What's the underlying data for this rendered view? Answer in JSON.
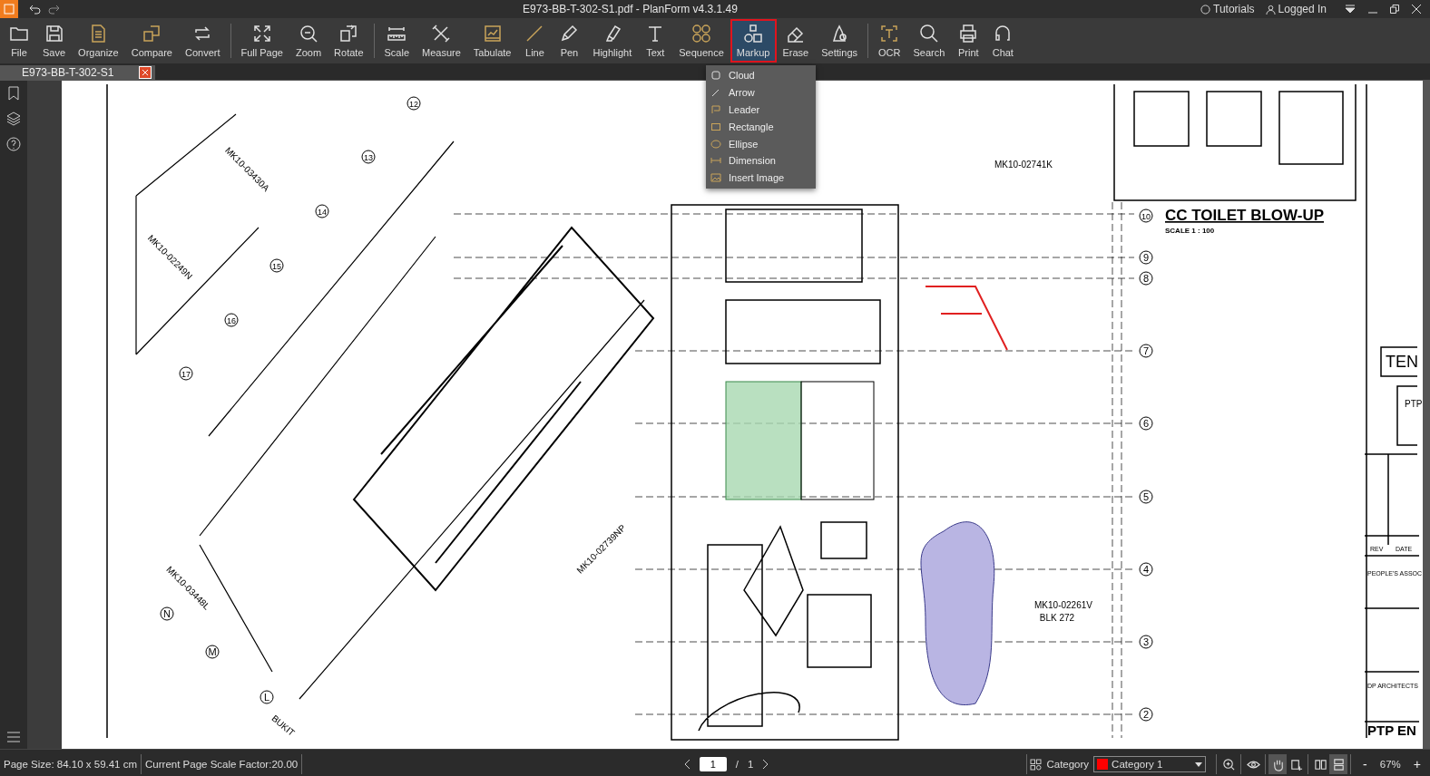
{
  "title_bar": {
    "title": "E973-BB-T-302-S1.pdf - PlanForm v4.3.1.49",
    "links": [
      "Tutorials",
      "Logged In"
    ]
  },
  "toolbar": {
    "groups": [
      [
        {
          "label": "File",
          "selected": false
        },
        {
          "label": "Save",
          "selected": false
        },
        {
          "label": "Organize",
          "selected": false
        },
        {
          "label": "Compare",
          "selected": false
        },
        {
          "label": "Convert",
          "selected": false
        }
      ],
      [
        {
          "label": "Full Page",
          "selected": false
        },
        {
          "label": "Zoom",
          "selected": false
        },
        {
          "label": "Rotate",
          "selected": false
        }
      ],
      [
        {
          "label": "Scale",
          "selected": false
        },
        {
          "label": "Measure",
          "selected": false
        },
        {
          "label": "Tabulate",
          "selected": false
        },
        {
          "label": "Line",
          "selected": false
        },
        {
          "label": "Pen",
          "selected": false
        },
        {
          "label": "Highlight",
          "selected": false
        },
        {
          "label": "Text",
          "selected": false
        },
        {
          "label": "Sequence",
          "selected": false
        },
        {
          "label": "Markup",
          "selected": true
        },
        {
          "label": "Erase",
          "selected": false
        },
        {
          "label": "Settings",
          "selected": false
        }
      ],
      [
        {
          "label": "OCR",
          "selected": false
        },
        {
          "label": "Search",
          "selected": false
        },
        {
          "label": "Print",
          "selected": false
        },
        {
          "label": "Chat",
          "selected": false
        }
      ]
    ]
  },
  "document_tab": {
    "label": "E973-BB-T-302-S1"
  },
  "markup_menu": {
    "items": [
      {
        "label": "Cloud"
      },
      {
        "label": "Arrow"
      },
      {
        "label": "Leader"
      },
      {
        "label": "Rectangle"
      },
      {
        "label": "Ellipse"
      },
      {
        "label": "Dimension"
      },
      {
        "label": "Insert Image"
      }
    ]
  },
  "drawing": {
    "grid_bubbles": [
      "10",
      "9",
      "8",
      "7",
      "6",
      "5",
      "4",
      "3",
      "2",
      "12",
      "13",
      "14",
      "15",
      "16",
      "17",
      "N",
      "M",
      "L"
    ],
    "labels": [
      "MK10-03430A",
      "MK10-02249N",
      "MK10-02741K",
      "MK10-02739NP",
      "MK10-03448L",
      "MK10-02261V",
      "BLK 272",
      "BUKIT"
    ],
    "title": "CC TOILET BLOW-UP",
    "scale": "SCALE 1 : 100",
    "title_block": [
      "TEN",
      "PTP",
      "REV",
      "DATE",
      "PEOPLE'S ASSOC",
      "DP ARCHITECTS",
      "PTP EN"
    ]
  },
  "status_bar": {
    "page_size": "Page Size: 84.10 x 59.41 cm",
    "scale_factor": "Current Page Scale Factor:20.00",
    "page_value": "1",
    "page_separator": "/",
    "page_total": "1",
    "category_label": "Category",
    "category": {
      "value": "Category 1",
      "color": "#ff0000"
    },
    "tools": [
      {
        "selected": false
      },
      {
        "selected": false
      },
      {
        "selected": true
      },
      {
        "selected": false
      },
      {
        "selected": false
      },
      {
        "selected": true
      }
    ],
    "zoom_out": "-",
    "zoom": "67%",
    "zoom_in": "+"
  }
}
